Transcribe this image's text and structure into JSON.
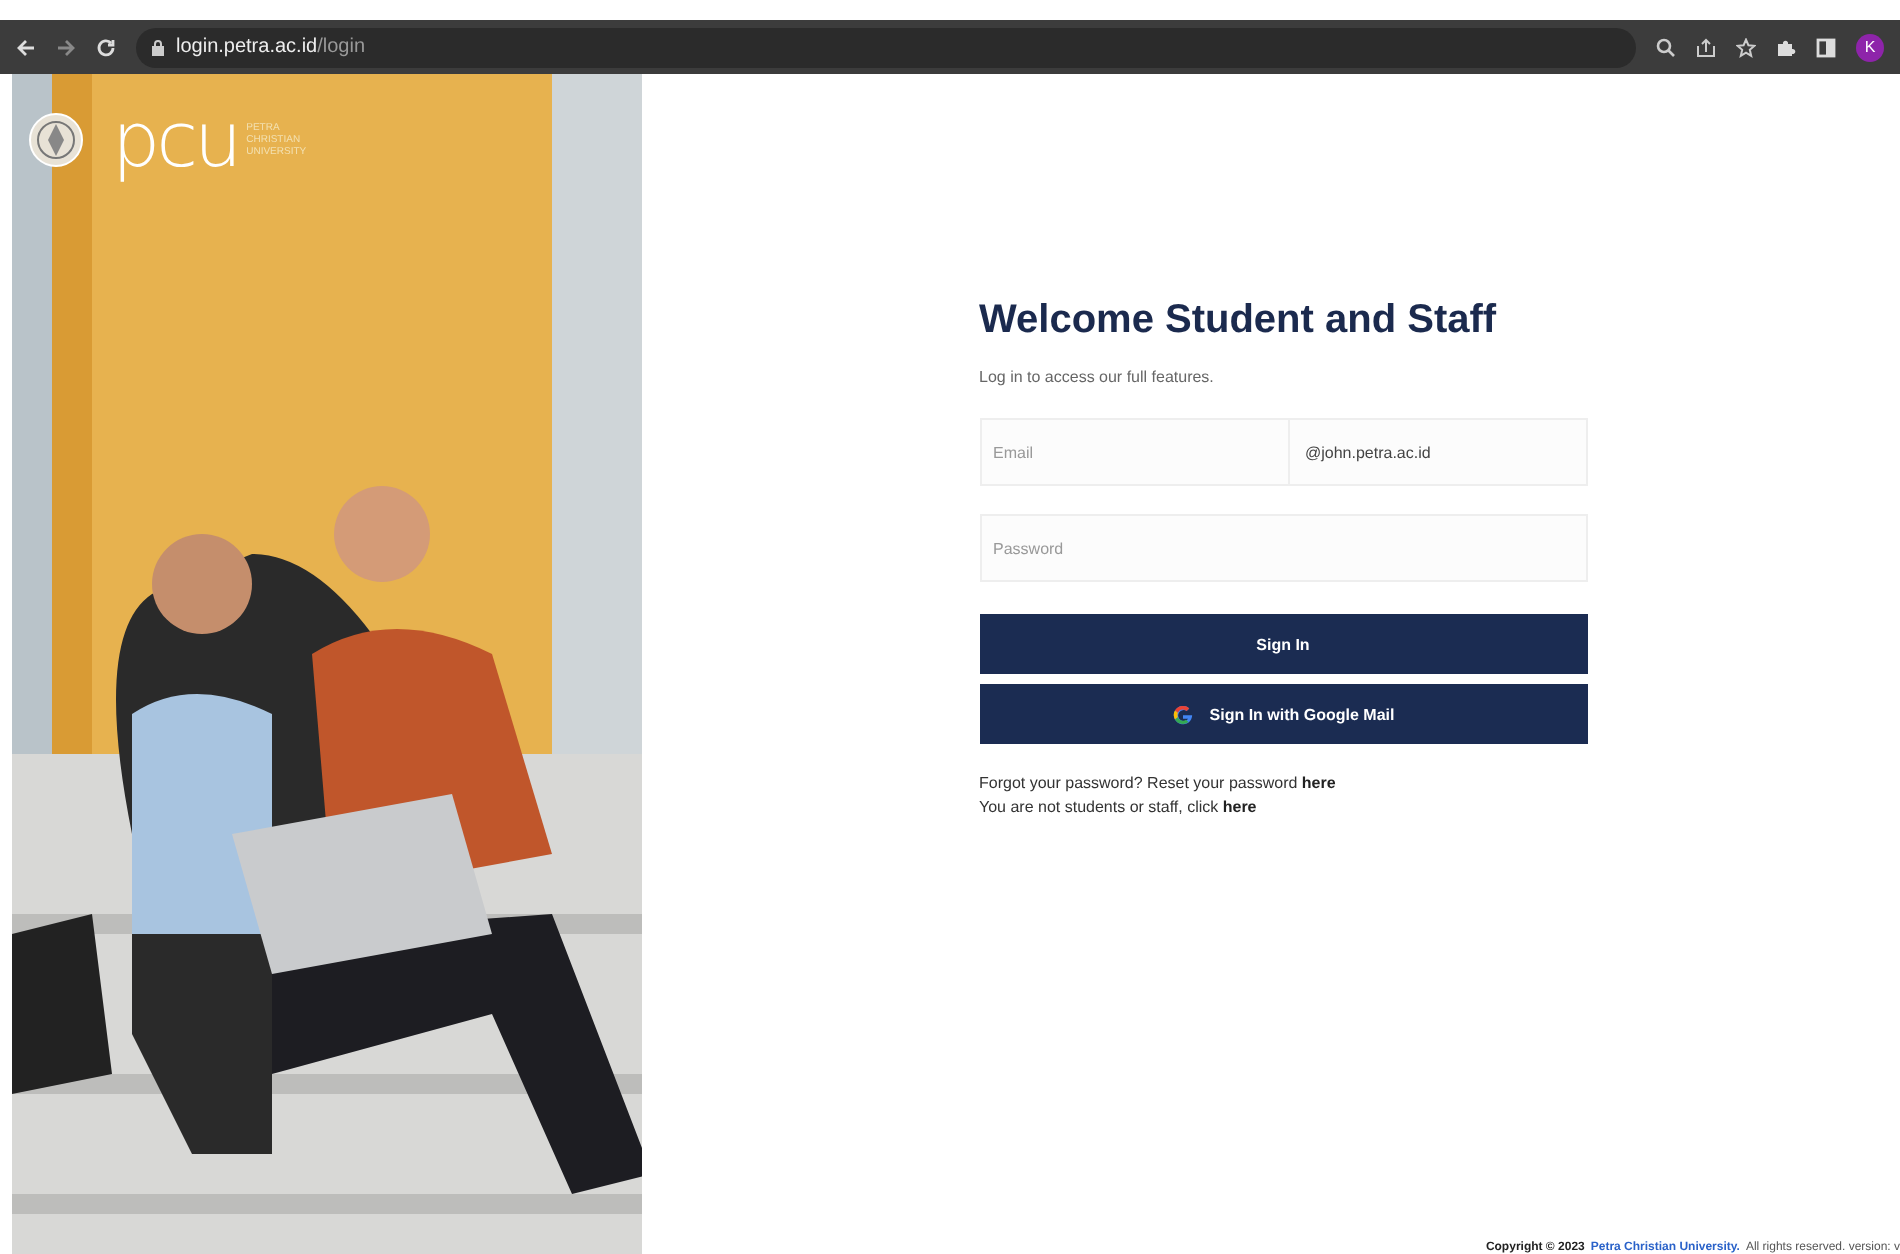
{
  "browser": {
    "url_host": "login.petra.ac.id",
    "url_path": "/login",
    "profile_initial": "K"
  },
  "hero": {
    "kind": "picture",
    "logo": {
      "mark": "pcu",
      "lines": [
        "PETRA",
        "CHRISTIAN",
        "UNIVERSITY"
      ]
    }
  },
  "login": {
    "title": "Welcome Student and Staff",
    "subtitle": "Log in to access our full features.",
    "email": {
      "placeholder": "Email",
      "domain": "@john.petra.ac.id"
    },
    "password": {
      "placeholder": "Password"
    },
    "buttons": [
      {
        "kind": "plain",
        "label": "Sign In"
      },
      {
        "kind": "google",
        "label": "Sign In with Google Mail"
      }
    ],
    "help": [
      {
        "text": "Forgot your password? Reset your password",
        "link": "here"
      },
      {
        "text": "You are not students or staff, click",
        "link": "here"
      }
    ]
  },
  "footer": {
    "text": "Copyright © 2023",
    "link": "Petra Christian University.",
    "rest": "All rights reserved. version: v"
  }
}
